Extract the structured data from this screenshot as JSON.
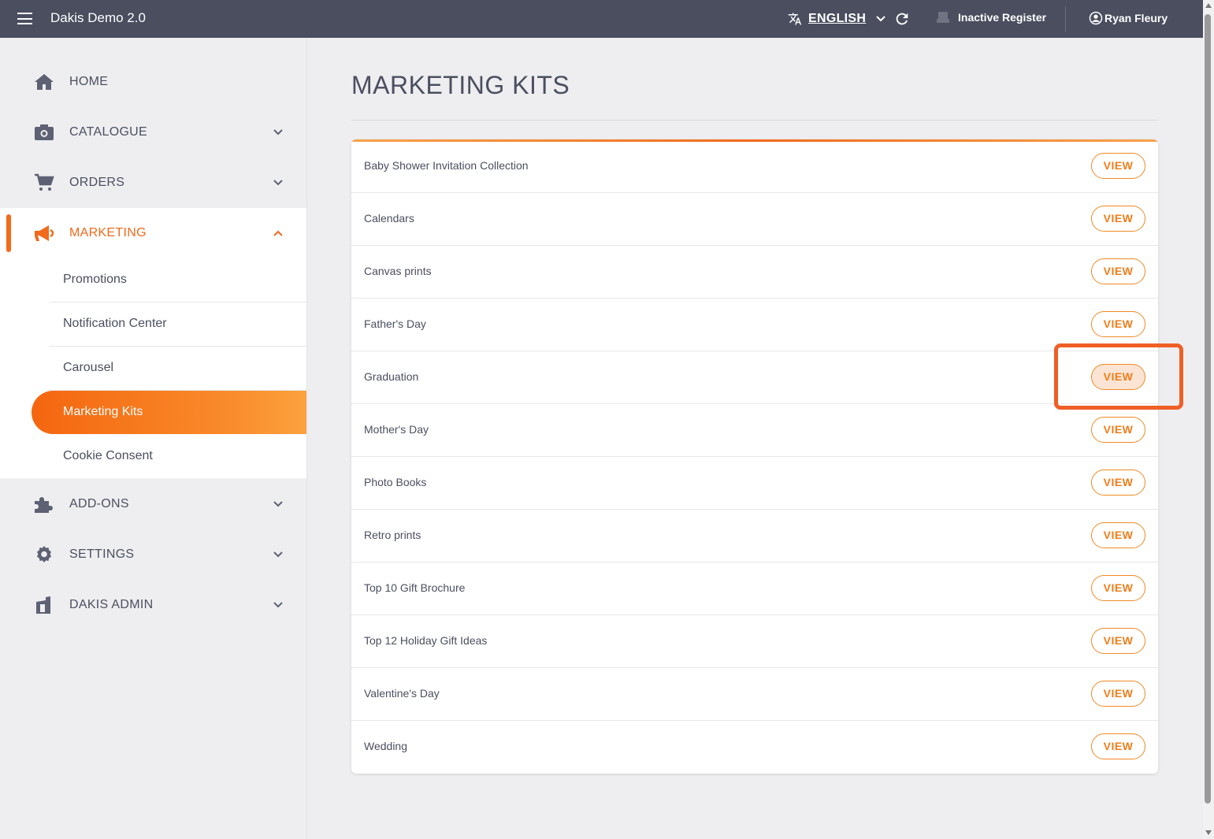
{
  "app": {
    "title": "Dakis Demo 2.0"
  },
  "topbar": {
    "language": "ENGLISH",
    "register_status": "Inactive Register",
    "user_name": "Ryan Fleury"
  },
  "sidebar": {
    "items": [
      {
        "label": "HOME",
        "icon": "home-icon",
        "expandable": false
      },
      {
        "label": "CATALOGUE",
        "icon": "camera-icon",
        "expandable": true
      },
      {
        "label": "ORDERS",
        "icon": "cart-icon",
        "expandable": true
      },
      {
        "label": "MARKETING",
        "icon": "megaphone-icon",
        "expandable": true,
        "expanded": true,
        "active": true
      },
      {
        "label": "ADD-ONS",
        "icon": "puzzle-icon",
        "expandable": true
      },
      {
        "label": "SETTINGS",
        "icon": "gear-icon",
        "expandable": true
      },
      {
        "label": "DAKIS ADMIN",
        "icon": "dakis-logo-icon",
        "expandable": true
      }
    ],
    "marketing_sub": [
      {
        "label": "Promotions"
      },
      {
        "label": "Notification Center"
      },
      {
        "label": "Carousel"
      },
      {
        "label": "Marketing Kits",
        "active": true
      },
      {
        "label": "Cookie Consent"
      }
    ]
  },
  "main": {
    "title": "MARKETING KITS",
    "view_label": "VIEW",
    "kits": [
      "Baby Shower Invitation Collection",
      "Calendars",
      "Canvas prints",
      "Father's Day",
      "Graduation",
      "Mother's Day",
      "Photo Books",
      "Retro prints",
      "Top 10 Gift Brochure",
      "Top 12 Holiday Gift Ideas",
      "Valentine's Day",
      "Wedding"
    ],
    "highlighted_kit": "Graduation"
  },
  "colors": {
    "topbar": "#4a4e5f",
    "accent": "#f26a1b",
    "highlight": "#ef5f26"
  }
}
